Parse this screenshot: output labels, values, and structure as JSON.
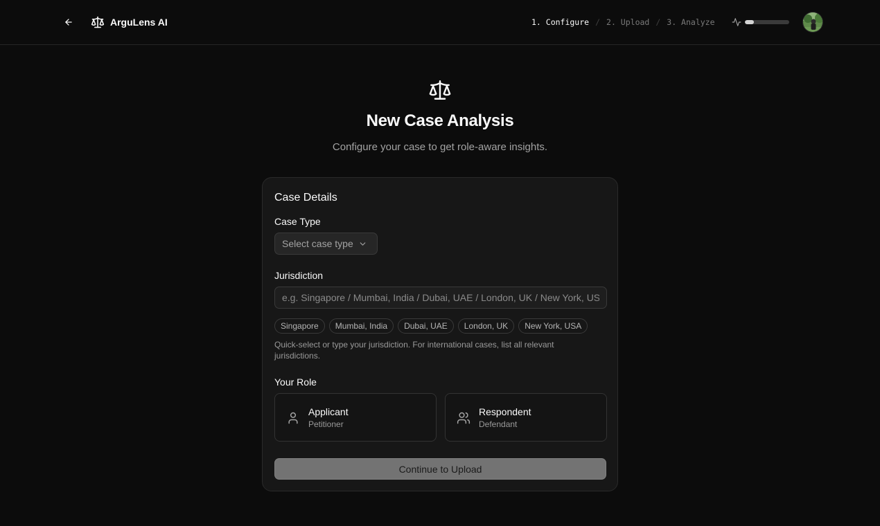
{
  "header": {
    "brand_name": "ArguLens AI",
    "steps": [
      "1. Configure",
      "2. Upload",
      "3. Analyze"
    ],
    "active_step": 0,
    "step_separator": "/",
    "progress": 0.2
  },
  "hero": {
    "title": "New Case Analysis",
    "subtitle": "Configure your case to get role-aware insights."
  },
  "form": {
    "card_title": "Case Details",
    "case_type": {
      "label": "Case Type",
      "value": "Select case type"
    },
    "jurisdiction": {
      "label": "Jurisdiction",
      "value": "",
      "placeholder": "e.g. Singapore / Mumbai, India / Dubai, UAE / London, UK / New York, USA",
      "chips": [
        "Singapore",
        "Mumbai, India",
        "Dubai, UAE",
        "London, UK",
        "New York, USA"
      ],
      "help": "Quick-select or type your jurisdiction. For international cases, list all relevant jurisdictions."
    },
    "role": {
      "label": "Your Role",
      "options": [
        {
          "title": "Applicant",
          "subtitle": "Petitioner",
          "icon": "user-icon"
        },
        {
          "title": "Respondent",
          "subtitle": "Defendant",
          "icon": "users-icon"
        }
      ]
    },
    "continue_label": "Continue to Upload"
  },
  "icons": {
    "back": "arrow-left-icon",
    "brand": "scale-icon",
    "activity": "activity-icon",
    "chevron": "chevron-down-icon"
  },
  "colors": {
    "background": "#0c0c0c",
    "card": "#171717",
    "border": "#2a2a2a",
    "text": "#fafafa",
    "muted": "#a3a3a3",
    "button_disabled": "#737373"
  }
}
